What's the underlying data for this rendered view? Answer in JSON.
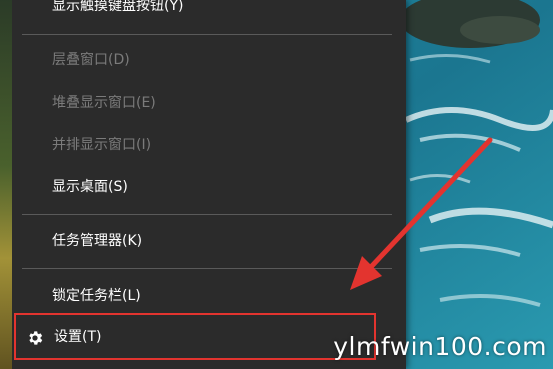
{
  "menu": {
    "items": [
      {
        "label": "显示触摸键盘按钮(Y)",
        "enabled": true
      },
      {
        "label": "层叠窗口(D)",
        "enabled": false
      },
      {
        "label": "堆叠显示窗口(E)",
        "enabled": false
      },
      {
        "label": "并排显示窗口(I)",
        "enabled": false
      },
      {
        "label": "显示桌面(S)",
        "enabled": true
      },
      {
        "label": "任务管理器(K)",
        "enabled": true
      },
      {
        "label": "锁定任务栏(L)",
        "enabled": true
      },
      {
        "label": "设置(T)",
        "enabled": true,
        "icon": "gear-icon",
        "highlighted": true
      }
    ]
  },
  "annotation": {
    "color": "#e3342f"
  },
  "watermark": "ylmfwin100.com"
}
